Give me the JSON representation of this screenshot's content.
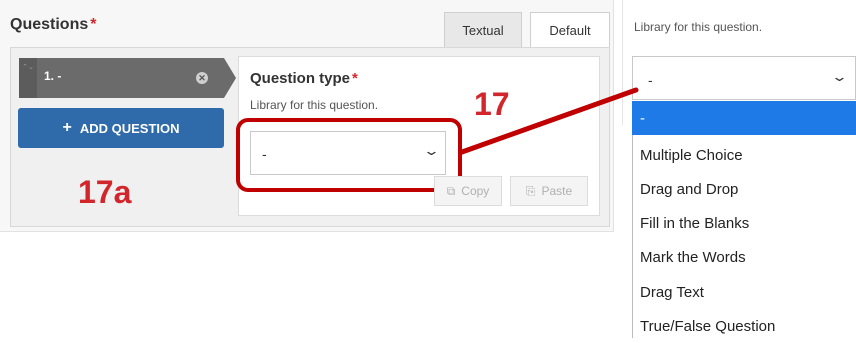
{
  "questions": {
    "label": "Questions",
    "required_mark": "*",
    "tabs": {
      "textual": "Textual",
      "default": "Default"
    },
    "item": {
      "label": "1. -",
      "remove_glyph": "✕",
      "handle_glyph": "⌃⌄"
    },
    "add_button": {
      "icon": "+",
      "label": "ADD QUESTION"
    }
  },
  "question_type": {
    "title": "Question type",
    "required_mark": "*",
    "description": "Library for this question.",
    "selected_value": "-",
    "chevron": "⌄",
    "copy": {
      "icon": "⧉",
      "label": "Copy"
    },
    "paste": {
      "icon": "⎘",
      "label": "Paste"
    }
  },
  "annotations": {
    "primary": "17",
    "secondary": "17a",
    "color": "#d3262c"
  },
  "right_panel": {
    "description": "Library for this question.",
    "selected_value": "-",
    "chevron": "⌄",
    "options": [
      "-",
      "Multiple Choice",
      "Drag and Drop",
      "Fill in the Blanks",
      "Mark the Words",
      "Drag Text",
      "True/False Question"
    ],
    "selected_index": 0
  },
  "colors": {
    "accent_blue": "#2f6aaa",
    "selected_option": "#1e7ae6",
    "highlight_red": "#c00000"
  }
}
